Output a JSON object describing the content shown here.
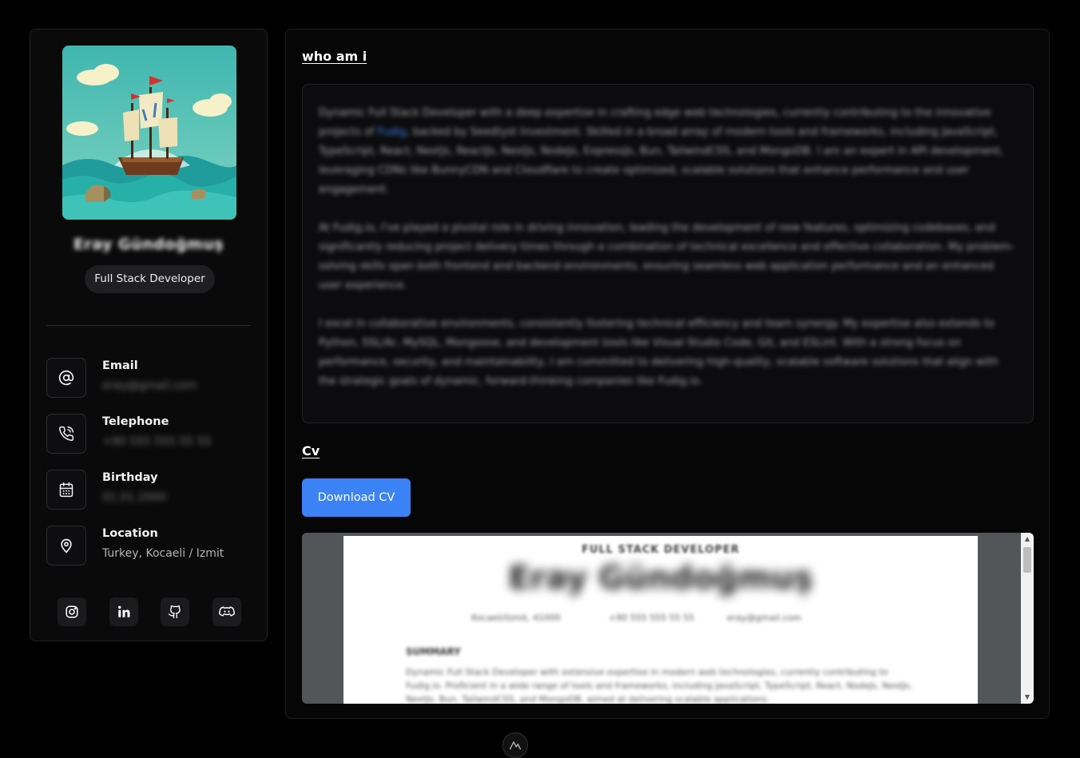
{
  "profile": {
    "name": "Eray Gündoğmuş",
    "role": "Full Stack Developer"
  },
  "contacts": [
    {
      "label": "Email",
      "value": "eray@gmail.com",
      "icon": "at-icon"
    },
    {
      "label": "Telephone",
      "value": "+90 555 555 55 55",
      "icon": "phone-icon"
    },
    {
      "label": "Birthday",
      "value": "01.01.2000",
      "icon": "calendar-icon"
    },
    {
      "label": "Location",
      "value": "Turkey, Kocaeli / Izmit",
      "icon": "location-pin-icon"
    }
  ],
  "social": [
    "instagram-icon",
    "linkedin-icon",
    "github-icon",
    "discord-icon"
  ],
  "main": {
    "about_title": "who am i",
    "about_paragraphs": [
      {
        "before": "Dynamic Full Stack Developer with a deep expertise in crafting edge web technologies, currently contributing to the innovative projects of ",
        "link": "Fudig",
        "after": ", backed by Seedtyst Investment. Skilled in a broad array of modern tools and frameworks, including JavaScript, TypeScript, React, NextJs, ReactJs, NestJs, NodeJs, ExpressJs, Bun, TailwindCSS, and MongoDB. I am an expert in API development, leveraging CDNs like BunnyCDN and Cloudflare to create optimized, scalable solutions that enhance performance and user engagement."
      },
      {
        "before": "At Fudig.io, I've played a pivotal role in driving innovation, leading the development of new features, optimizing codebases, and significantly reducing project delivery times through a combination of technical excellence and effective collaboration. My problem-solving skills span both frontend and backend environments, ensuring seamless web application performance and an enhanced user experience.",
        "link": "",
        "after": ""
      },
      {
        "before": "I excel in collaborative environments, consistently fostering technical efficiency and team synergy. My expertise also extends to Python, SSL/Ar, MySQL, Mongoose, and development tools like Visual Studio Code, Git, and ESLint. With a strong focus on performance, security, and maintainability, I am committed to delivering high-quality, scalable software solutions that align with the strategic goals of dynamic, forward-thinking companies like Fudig.io.",
        "link": "",
        "after": ""
      }
    ],
    "cv_title": "Cv",
    "download_label": "Download CV"
  },
  "cv_document": {
    "headline": "FULL STACK DEVELOPER",
    "name": "Eray Gündoğmuş",
    "location": "Kocaeli/Izmit, 41000",
    "phone": "+90 555 555 55 55",
    "email": "eray@gmail.com",
    "summary_title": "SUMMARY",
    "summary_text": "Dynamic Full Stack Developer with extensive expertise in modern web technologies, currently contributing to Fudig.io. Proficient in a wide range of tools and frameworks, including JavaScript, TypeScript, React, NodeJs, NestJs, NextJs, Bun, TailwindCSS, and MongoDB, aimed at delivering scalable applications."
  },
  "colors": {
    "accent": "#3b82f6",
    "background": "#000000",
    "card": "#0a0a0b"
  }
}
